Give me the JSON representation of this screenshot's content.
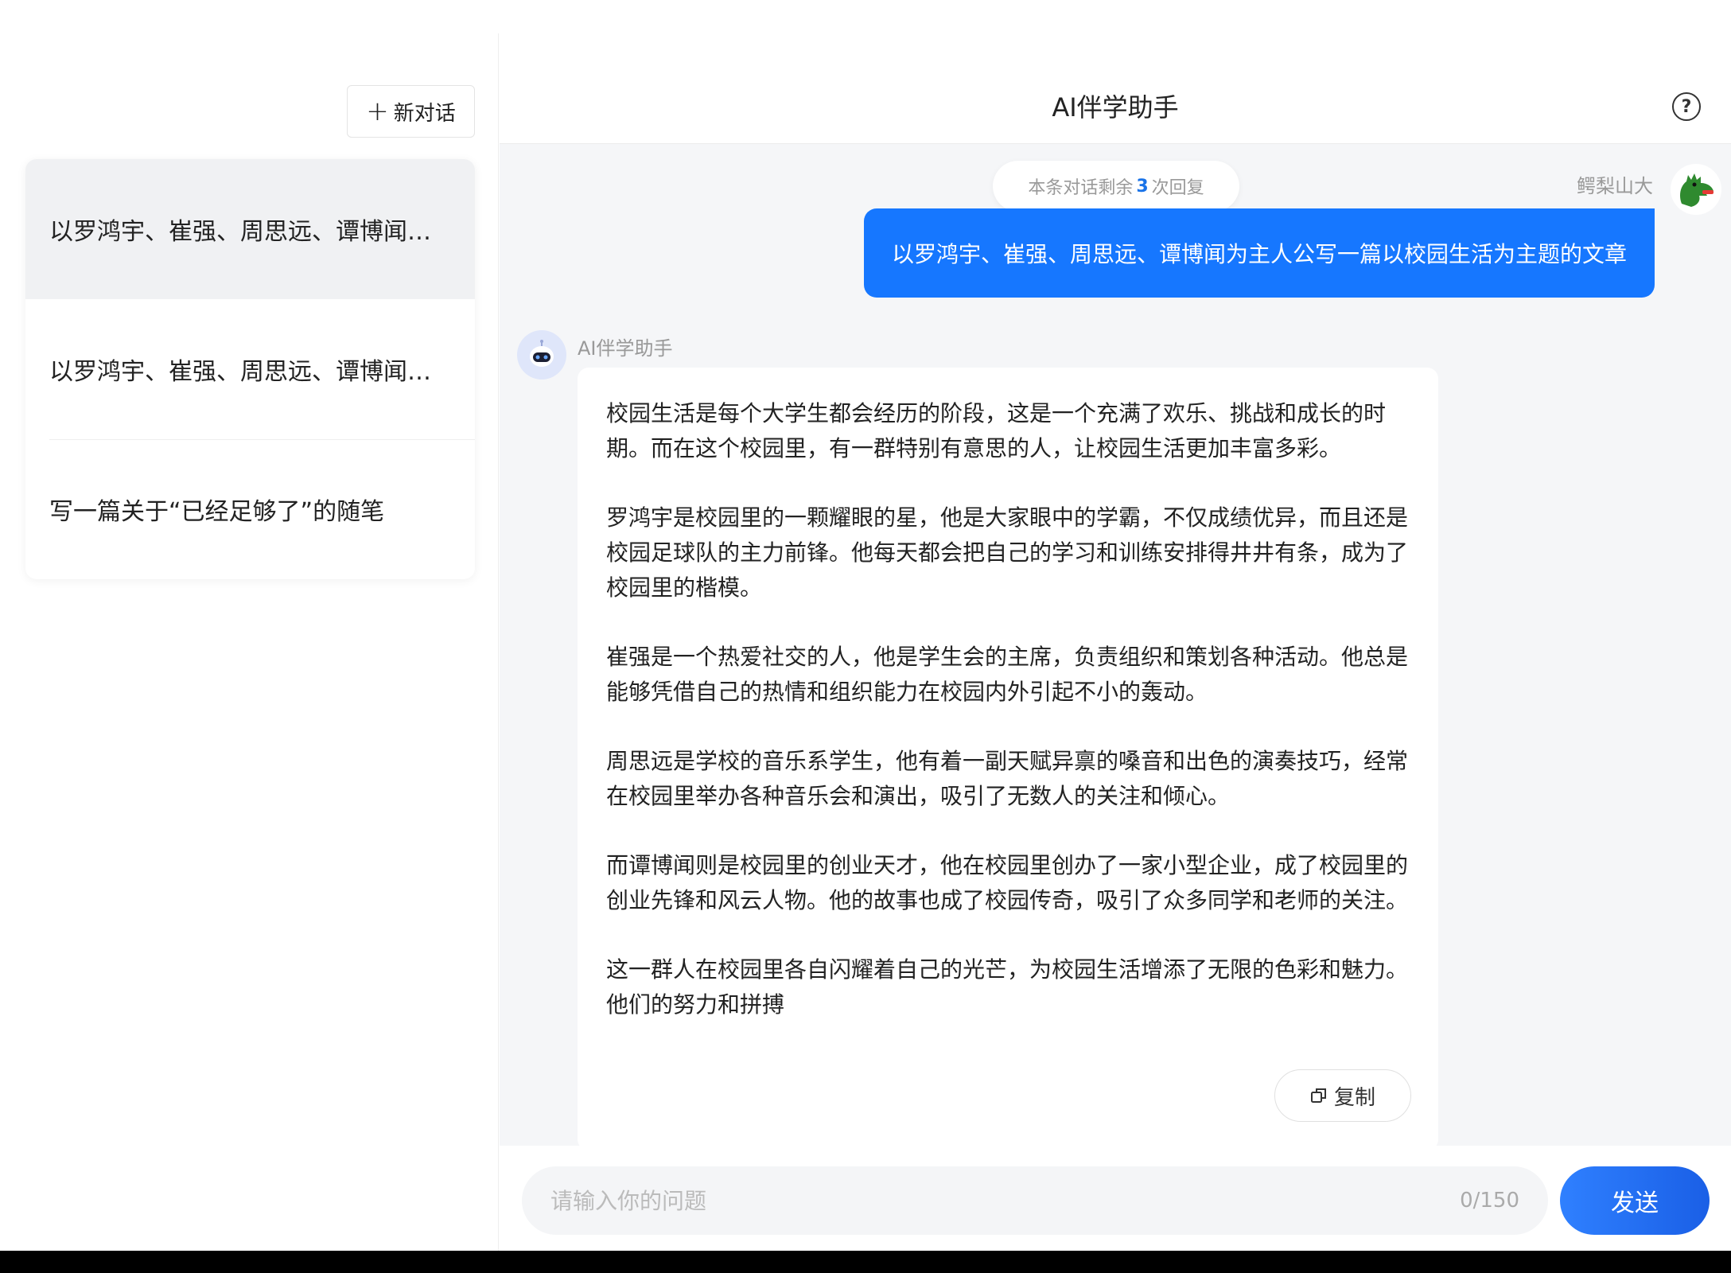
{
  "sidebar": {
    "new_chat_label": "新对话",
    "items": [
      {
        "label": "以罗鸿宇、崔强、周思远、谭博闻为主人公写一篇以校园生活为主题的文章"
      },
      {
        "label": "以罗鸿宇、崔强、周思远、谭博闻为主人公写一篇以校园生活为主题的文章"
      },
      {
        "label": "写一篇关于“已经足够了”的随笔"
      }
    ]
  },
  "header": {
    "title": "AI伴学助手"
  },
  "conversation": {
    "remaining_prefix": "本条对话剩余",
    "remaining_count": "3",
    "remaining_suffix": "次回复",
    "user_name": "鳄梨山大",
    "user_message": "以罗鸿宇、崔强、周思远、谭博闻为主人公写一篇以校园生活为主题的文章",
    "bot_name": "AI伴学助手",
    "bot_paragraphs": [
      "校园生活是每个大学生都会经历的阶段，这是一个充满了欢乐、挑战和成长的时期。而在这个校园里，有一群特别有意思的人，让校园生活更加丰富多彩。",
      "罗鸿宇是校园里的一颗耀眼的星，他是大家眼中的学霸，不仅成绩优异，而且还是校园足球队的主力前锋。他每天都会把自己的学习和训练安排得井井有条，成为了校园里的楷模。",
      "崔强是一个热爱社交的人，他是学生会的主席，负责组织和策划各种活动。他总是能够凭借自己的热情和组织能力在校园内外引起不小的轰动。",
      "周思远是学校的音乐系学生，他有着一副天赋异禀的嗓音和出色的演奏技巧，经常在校园里举办各种音乐会和演出，吸引了无数人的关注和倾心。",
      "而谭博闻则是校园里的创业天才，他在校园里创办了一家小型企业，成了校园里的创业先锋和风云人物。他的故事也成了校园传奇，吸引了众多同学和老师的关注。",
      "这一群人在校园里各自闪耀着自己的光芒，为校园生活增添了无限的色彩和魅力。他们的努力和拼搏"
    ],
    "copy_label": "复制"
  },
  "input": {
    "placeholder": "请输入你的问题",
    "char_count": "0/150",
    "send_label": "发送"
  },
  "icons": {
    "plus": "plus-icon",
    "help": "help-icon",
    "copy": "copy-icon"
  },
  "colors": {
    "accent": "#1677ff",
    "active_item_bg": "#f0f1f3"
  }
}
